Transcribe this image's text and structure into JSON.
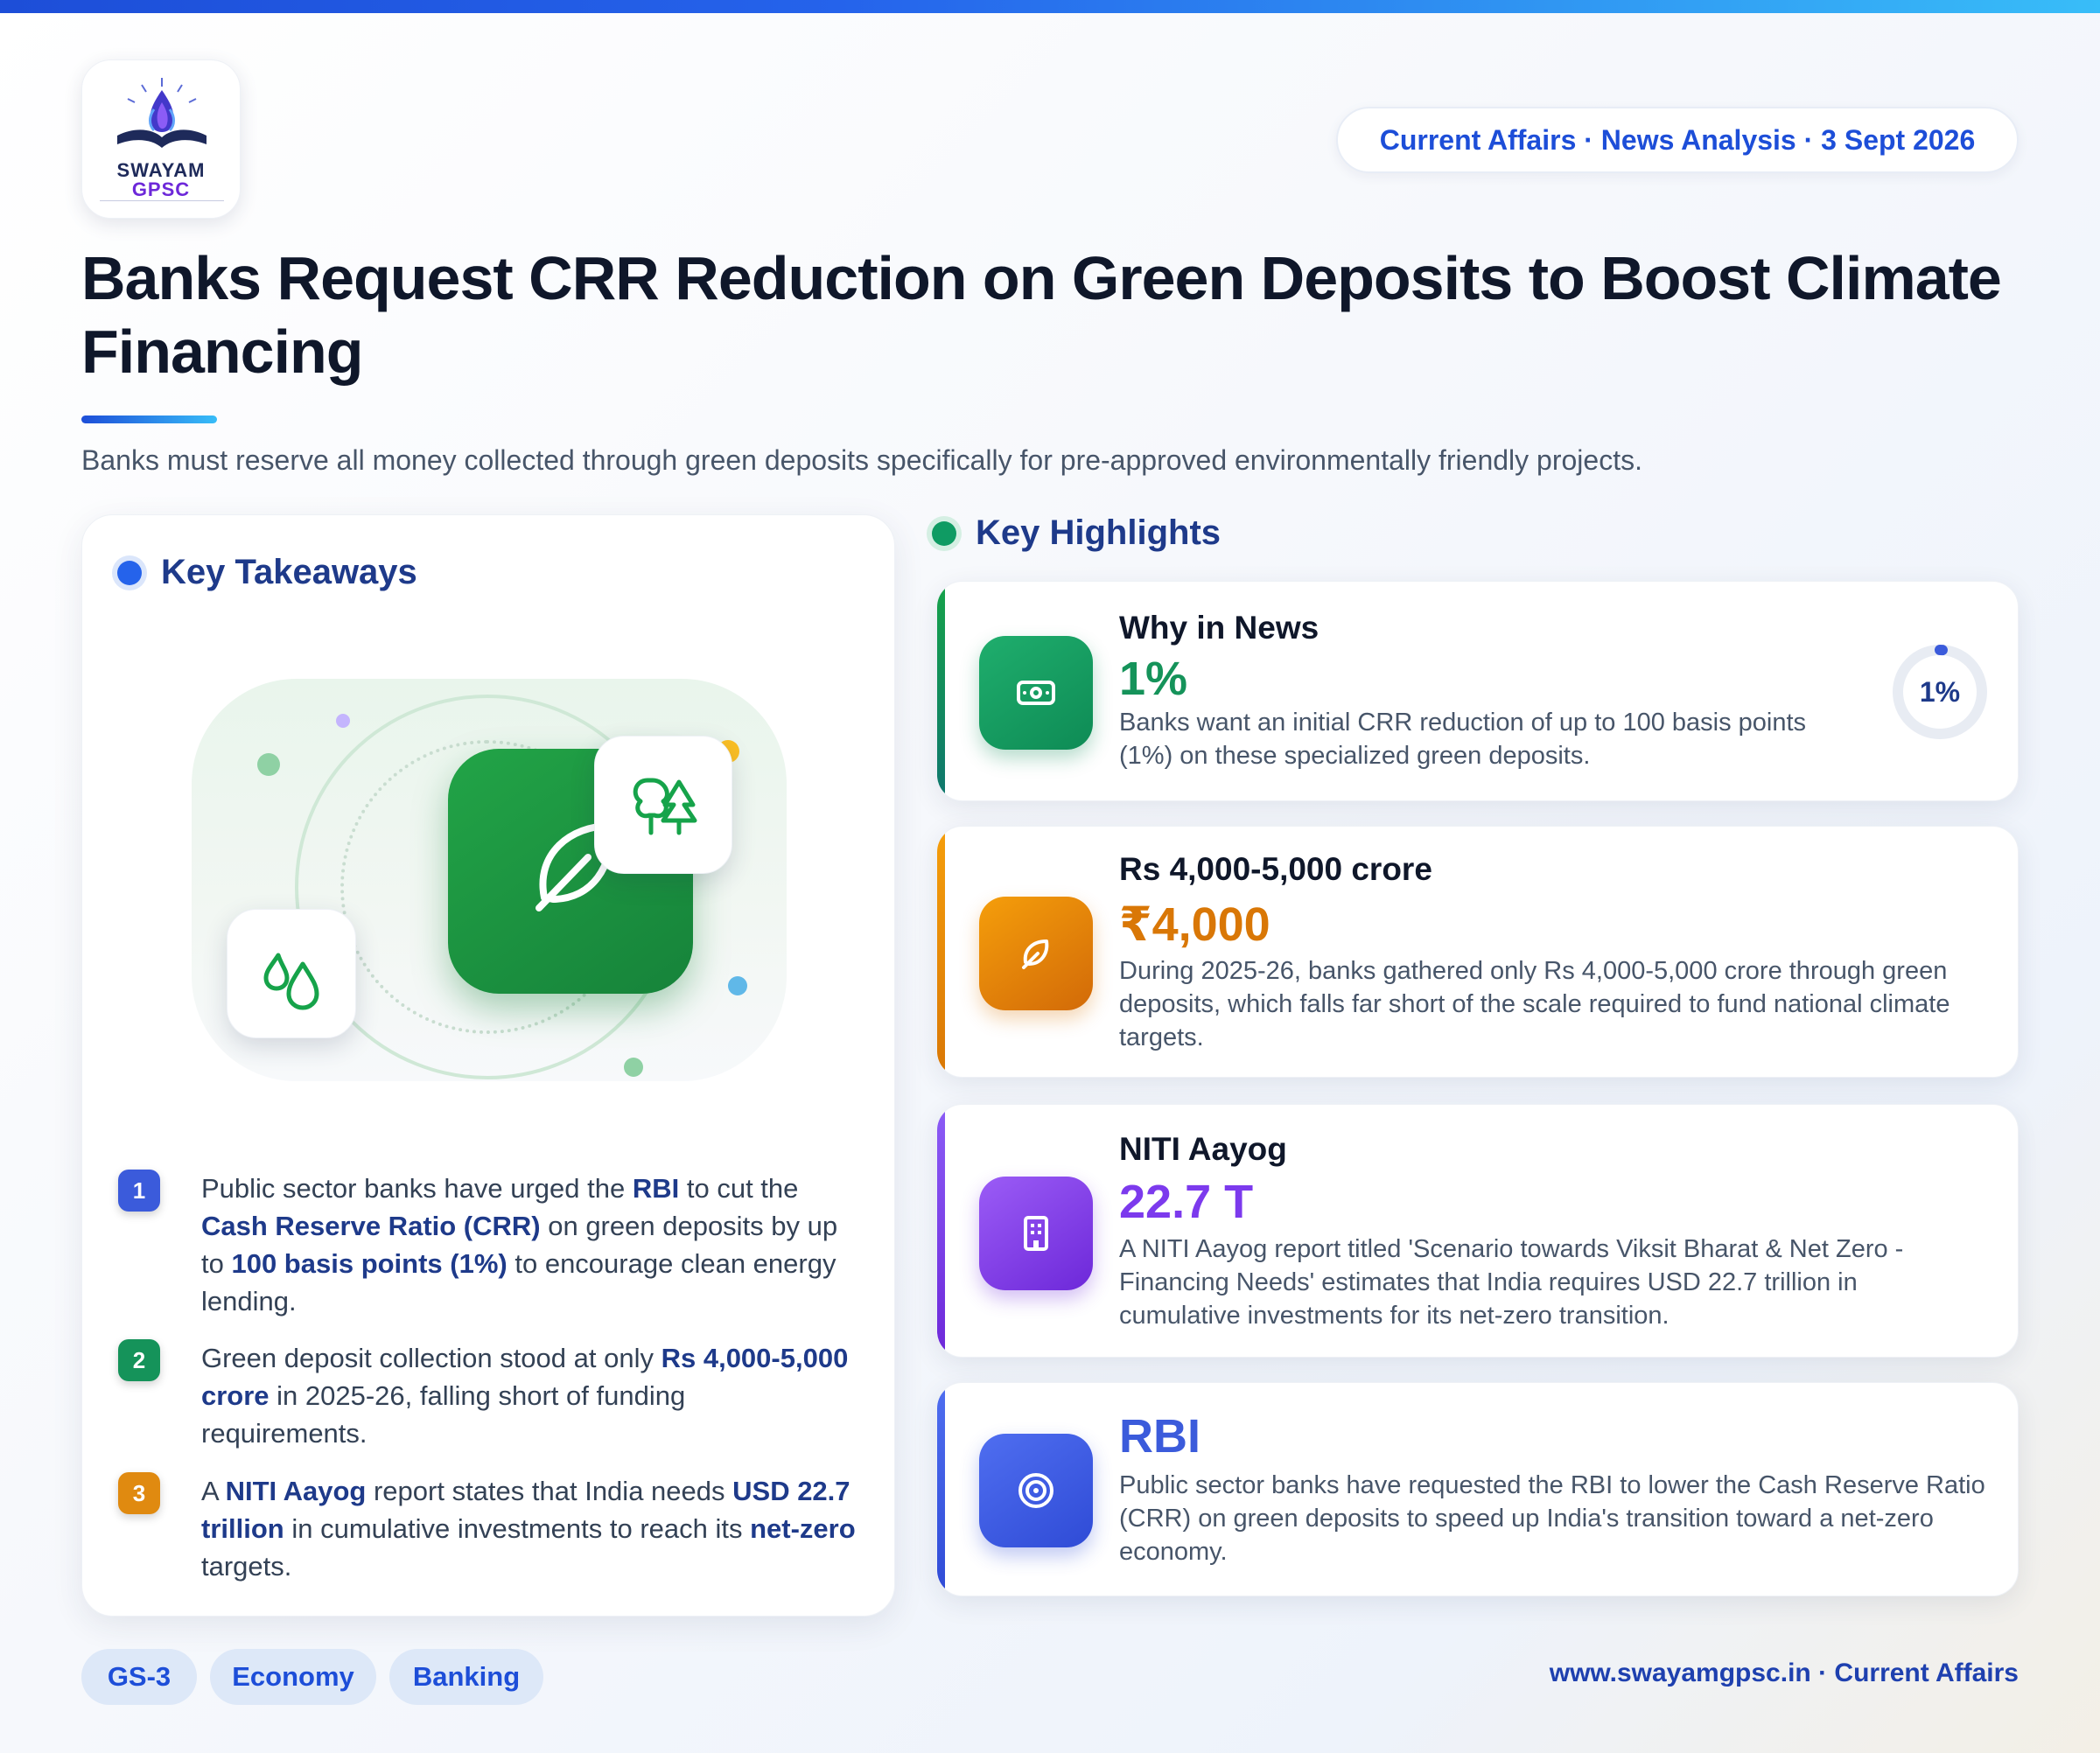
{
  "brand": {
    "line1": "SWAYAM",
    "line2": "GPSC"
  },
  "header": {
    "tagline": "Current Affairs · News Analysis · 3 Sept 2026"
  },
  "title": "Banks Request CRR Reduction on Green Deposits to Boost Climate Financing",
  "subtitle": "Banks must reserve all money collected through green deposits specifically for pre-approved environmentally friendly projects.",
  "takeaways": {
    "heading": "Key Takeaways",
    "items": [
      {
        "num": "1",
        "parts": [
          {
            "t": "Public sector banks have urged the ",
            "b": false
          },
          {
            "t": "RBI",
            "b": true
          },
          {
            "t": " to cut the ",
            "b": false
          },
          {
            "t": "Cash Reserve Ratio (CRR)",
            "b": true
          },
          {
            "t": " on green deposits by up to ",
            "b": false
          },
          {
            "t": "100 basis points (1%)",
            "b": true
          },
          {
            "t": " to encourage clean energy lending.",
            "b": false
          }
        ]
      },
      {
        "num": "2",
        "parts": [
          {
            "t": "Green deposit collection stood at only ",
            "b": false
          },
          {
            "t": "Rs 4,000-5,000 crore",
            "b": true
          },
          {
            "t": " in 2025-26, falling short of funding requirements.",
            "b": false
          }
        ]
      },
      {
        "num": "3",
        "parts": [
          {
            "t": "A ",
            "b": false
          },
          {
            "t": "NITI Aayog",
            "b": true
          },
          {
            "t": " report states that India needs ",
            "b": false
          },
          {
            "t": "USD 22.7 trillion",
            "b": true
          },
          {
            "t": " in cumulative investments to reach its ",
            "b": false
          },
          {
            "t": "net-zero",
            "b": true
          },
          {
            "t": " targets.",
            "b": false
          }
        ]
      }
    ]
  },
  "highlights": {
    "heading": "Key Highlights",
    "cards": [
      {
        "heading": "Why in News",
        "value": "1%",
        "gauge": "1%",
        "gauge_fraction": 0.01,
        "desc": "Banks want an initial CRR reduction of up to 100 basis points (1%) on these specialized green deposits."
      },
      {
        "heading": "Rs 4,000-5,000 crore",
        "value": "₹4,000",
        "desc": "During 2025-26, banks gathered only Rs 4,000-5,000 crore through green deposits, which falls far short of the scale required to fund national climate targets."
      },
      {
        "heading": "NITI Aayog",
        "value": "22.7 T",
        "desc": "A NITI Aayog report titled 'Scenario towards Viksit Bharat & Net Zero - Financing Needs' estimates that India requires USD 22.7 trillion in cumulative investments for its net-zero transition."
      },
      {
        "heading": "",
        "value": "RBI",
        "desc": "Public sector banks have requested the RBI to lower the Cash Reserve Ratio (CRR) on green deposits to speed up India's transition toward a net-zero economy."
      }
    ]
  },
  "tags": [
    "GS-3",
    "Economy",
    "Banking"
  ],
  "footer": "www.swayamgpsc.in · Current Affairs",
  "colors": {
    "primary": "#1d4ed8",
    "green": "#16a34a",
    "orange": "#d97706",
    "purple": "#7c3aed",
    "blue": "#3b5bdb"
  }
}
